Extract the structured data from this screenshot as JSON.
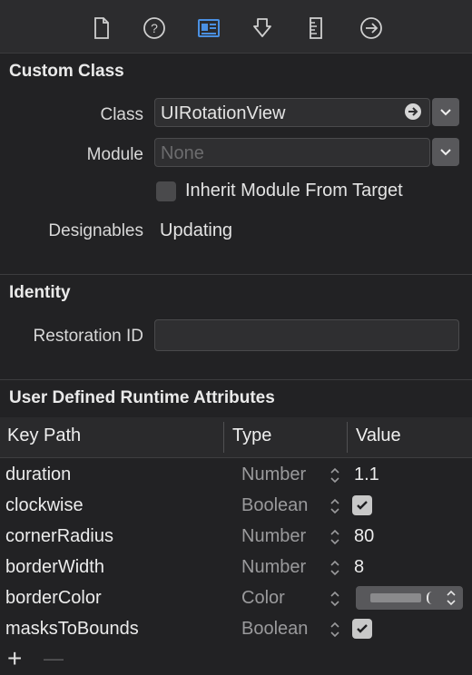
{
  "toolbar": {
    "icons": [
      "file-icon",
      "help-icon",
      "identity-inspector-icon",
      "attributes-inspector-icon",
      "size-inspector-icon",
      "connections-icon"
    ]
  },
  "custom_class": {
    "title": "Custom Class",
    "class_label": "Class",
    "class_value": "UIRotationView",
    "module_label": "Module",
    "module_placeholder": "None",
    "inherit_label": "Inherit Module From Target",
    "designables_label": "Designables",
    "designables_value": "Updating"
  },
  "identity": {
    "title": "Identity",
    "restoration_label": "Restoration ID",
    "restoration_value": ""
  },
  "runtime": {
    "title": "User Defined Runtime Attributes",
    "columns": {
      "key": "Key Path",
      "type": "Type",
      "value": "Value"
    },
    "rows": [
      {
        "key": "duration",
        "type": "Number",
        "value": "1.1"
      },
      {
        "key": "clockwise",
        "type": "Boolean",
        "value": "checked"
      },
      {
        "key": "cornerRadius",
        "type": "Number",
        "value": "80"
      },
      {
        "key": "borderWidth",
        "type": "Number",
        "value": "8"
      },
      {
        "key": "borderColor",
        "type": "Color",
        "value": "color-well"
      },
      {
        "key": "masksToBounds",
        "type": "Boolean",
        "value": "checked"
      }
    ],
    "add_symbol": "+",
    "remove_symbol": "—"
  },
  "colors": {
    "accent": "#4a90e2",
    "background": "#222224",
    "panel": "#2c2c2e"
  }
}
